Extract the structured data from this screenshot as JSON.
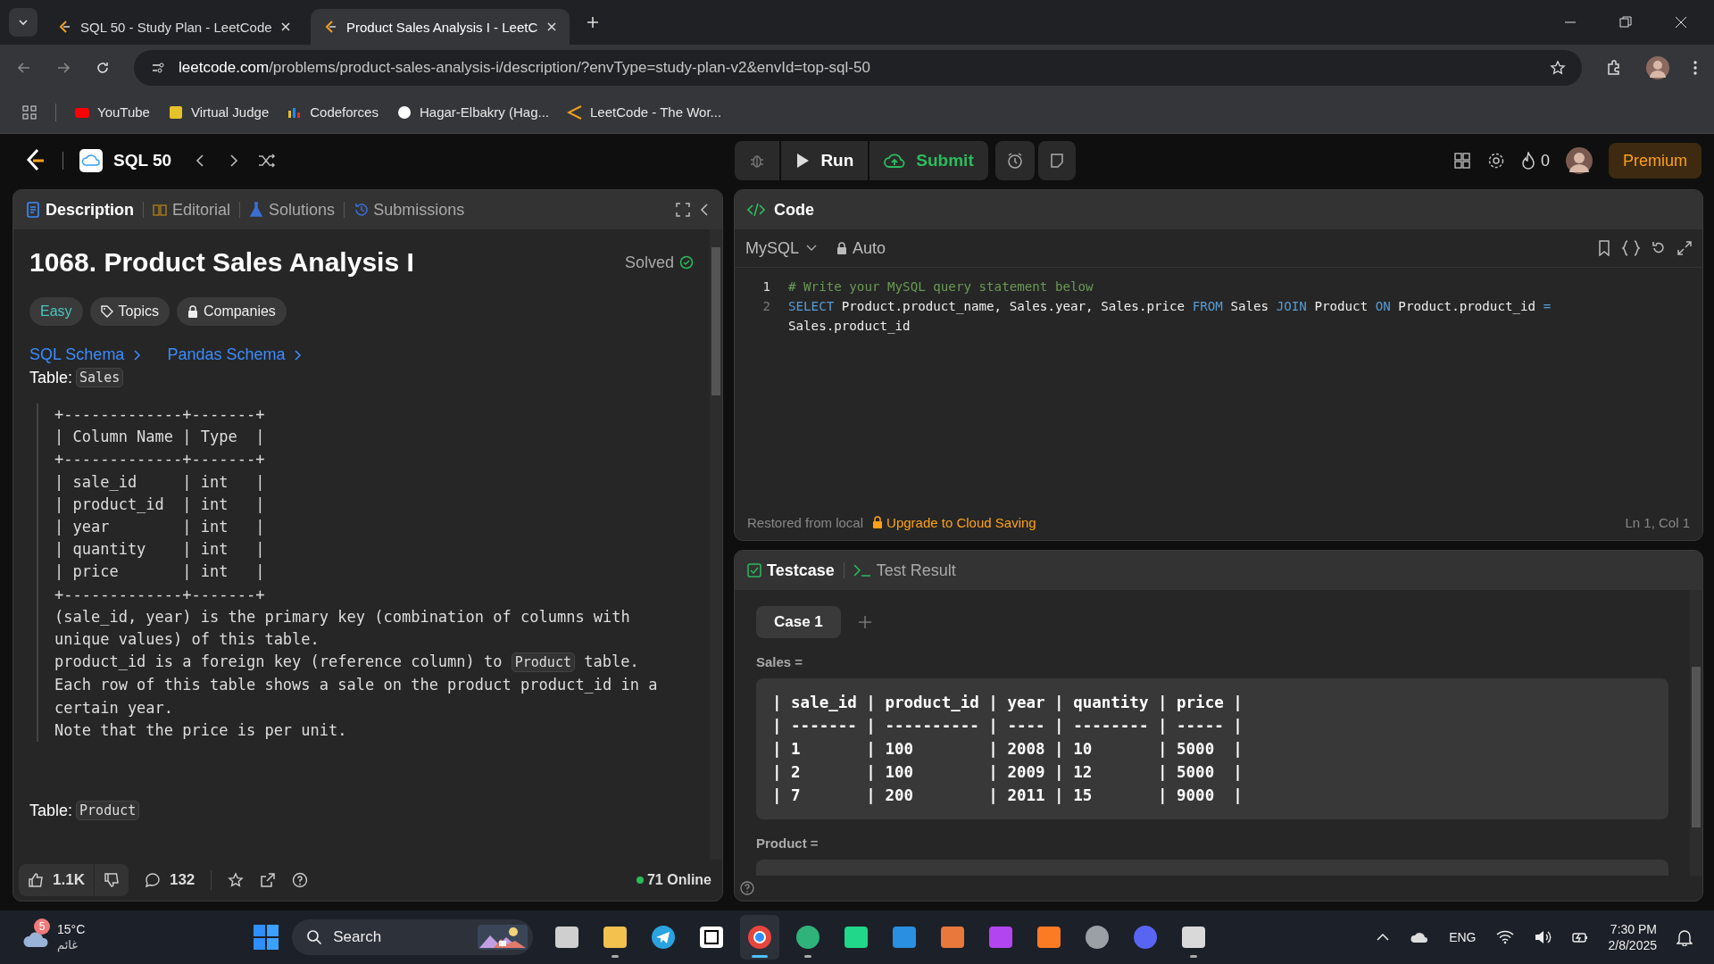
{
  "browser": {
    "tabs": [
      {
        "title": "SQL 50 - Study Plan - LeetCode",
        "selected": false
      },
      {
        "title": "Product Sales Analysis I - LeetC",
        "selected": true
      }
    ],
    "url": {
      "host": "leetcode.com",
      "path": "/problems/product-sales-analysis-i/description/?envType=study-plan-v2&envId=top-sql-50"
    },
    "bookmarks": [
      {
        "label": "YouTube",
        "kind": "youtube"
      },
      {
        "label": "Virtual Judge",
        "kind": "vjudge"
      },
      {
        "label": "Codeforces",
        "kind": "codeforces"
      },
      {
        "label": "Hagar-Elbakry (Hag...",
        "kind": "github"
      },
      {
        "label": "LeetCode - The Wor...",
        "kind": "leetcode"
      }
    ]
  },
  "header": {
    "list_name": "SQL 50",
    "run": "Run",
    "submit": "Submit",
    "streak": "0",
    "premium": "Premium"
  },
  "description": {
    "tabs": [
      {
        "label": "Description",
        "kind": "doc",
        "selected": true
      },
      {
        "label": "Editorial",
        "kind": "book",
        "selected": false
      },
      {
        "label": "Solutions",
        "kind": "flask",
        "selected": false
      },
      {
        "label": "Submissions",
        "kind": "history",
        "selected": false
      }
    ],
    "title": "1068. Product Sales Analysis I",
    "status": "Solved",
    "tags": [
      {
        "label": "Easy",
        "kind": "difficulty"
      },
      {
        "label": "Topics",
        "kind": "tag"
      },
      {
        "label": "Companies",
        "kind": "lock"
      }
    ],
    "schema_links": [
      "SQL Schema",
      "Pandas Schema"
    ],
    "table_label": "Table:",
    "table_name": "Sales",
    "schema_lines": [
      "+-------------+-------+",
      "| Column Name | Type  |",
      "+-------------+-------+",
      "| sale_id     | int   |",
      "| product_id  | int   |",
      "| year        | int   |",
      "| quantity    | int   |",
      "| price       | int   |",
      "+-------------+-------+"
    ],
    "notes": [
      [
        {
          "text": "(sale_id, year) is the primary key (combination of columns with unique values) of this table.",
          "kind": "text"
        }
      ],
      [
        {
          "text": "product_id is a foreign key (reference column) to ",
          "kind": "text"
        },
        {
          "text": "Product",
          "kind": "code"
        },
        {
          "text": " table.",
          "kind": "text"
        }
      ],
      [
        {
          "text": "Each row of this table shows a sale on the product product_id in a certain year.",
          "kind": "text"
        }
      ],
      [
        {
          "text": "Note that the price is per unit.",
          "kind": "text"
        }
      ]
    ],
    "table2_label": "Table:",
    "table2_name": "Product",
    "likes": "1.1K",
    "comments": "132",
    "online": "71 Online"
  },
  "editor": {
    "title": "Code",
    "language": "MySQL",
    "mode": "Auto",
    "lines": [
      {
        "number": "1",
        "tokens": [
          {
            "text": "# Write your MySQL query statement below",
            "kind": "comment"
          }
        ]
      },
      {
        "number": "2",
        "tokens": [
          {
            "text": "SELECT",
            "kind": "keyword"
          },
          {
            "text": " Product.product_name, Sales.year, Sales.price ",
            "kind": "plain"
          },
          {
            "text": "FROM",
            "kind": "keyword"
          },
          {
            "text": " Sales ",
            "kind": "plain"
          },
          {
            "text": "JOIN",
            "kind": "keyword"
          },
          {
            "text": " Product ",
            "kind": "plain"
          },
          {
            "text": "ON",
            "kind": "keyword"
          },
          {
            "text": " Product.product_id ",
            "kind": "plain"
          },
          {
            "text": "=",
            "kind": "keyword"
          },
          {
            "text": " Sales.product_id",
            "kind": "plain"
          }
        ]
      }
    ],
    "restored": "Restored from local",
    "upgrade": "Upgrade to Cloud Saving",
    "cursor": "Ln 1, Col 1"
  },
  "testcase": {
    "tabs": [
      {
        "label": "Testcase",
        "kind": "check",
        "selected": true
      },
      {
        "label": "Test Result",
        "kind": "terminal",
        "selected": false
      }
    ],
    "cases": [
      {
        "label": "Case 1",
        "selected": true
      }
    ],
    "inputs": [
      {
        "label": "Sales =",
        "lines": [
          "| sale_id | product_id | year | quantity | price |",
          "| ------- | ---------- | ---- | -------- | ----- |",
          "| 1       | 100        | 2008 | 10       | 5000  |",
          "| 2       | 100        | 2009 | 12       | 5000  |",
          "| 7       | 200        | 2011 | 15       | 9000  |"
        ]
      },
      {
        "label": "Product ="
      }
    ]
  },
  "taskbar": {
    "weather": {
      "badge": "5",
      "temp": "15°C",
      "condition": "غائم"
    },
    "search": "Search",
    "apps": [
      {
        "kind": "taskview",
        "running": false,
        "selected": false
      },
      {
        "kind": "files",
        "running": true,
        "selected": false
      },
      {
        "kind": "telegram",
        "running": false,
        "selected": false
      },
      {
        "kind": "notion",
        "running": false,
        "selected": false
      },
      {
        "kind": "chrome",
        "running": true,
        "selected": true
      },
      {
        "kind": "edge",
        "running": true,
        "selected": false
      },
      {
        "kind": "clion",
        "running": false,
        "selected": false
      },
      {
        "kind": "vscode",
        "running": false,
        "selected": false
      },
      {
        "kind": "git",
        "running": false,
        "selected": false
      },
      {
        "kind": "phpstorm",
        "running": false,
        "selected": false
      },
      {
        "kind": "xampp",
        "running": false,
        "selected": false
      },
      {
        "kind": "obs",
        "running": false,
        "selected": false
      },
      {
        "kind": "discord",
        "running": false,
        "selected": false
      },
      {
        "kind": "snip",
        "running": true,
        "selected": false
      }
    ],
    "language": "ENG",
    "time": "7:30 PM",
    "date": "2/8/2025"
  }
}
